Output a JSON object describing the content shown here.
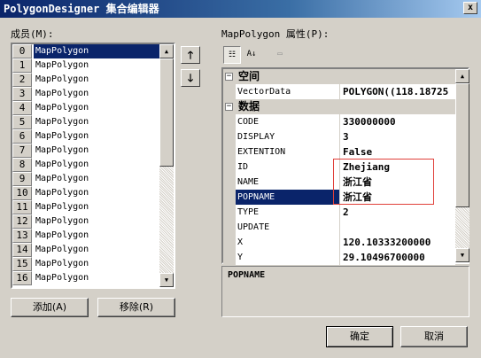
{
  "window": {
    "title": "PolygonDesigner 集合编辑器",
    "close_glyph": "x"
  },
  "members": {
    "label": "成员(M):",
    "items": [
      {
        "index": "0",
        "name": "MapPolygon",
        "selected": true
      },
      {
        "index": "1",
        "name": "MapPolygon"
      },
      {
        "index": "2",
        "name": "MapPolygon"
      },
      {
        "index": "3",
        "name": "MapPolygon"
      },
      {
        "index": "4",
        "name": "MapPolygon"
      },
      {
        "index": "5",
        "name": "MapPolygon"
      },
      {
        "index": "6",
        "name": "MapPolygon"
      },
      {
        "index": "7",
        "name": "MapPolygon"
      },
      {
        "index": "8",
        "name": "MapPolygon"
      },
      {
        "index": "9",
        "name": "MapPolygon"
      },
      {
        "index": "10",
        "name": "MapPolygon"
      },
      {
        "index": "11",
        "name": "MapPolygon"
      },
      {
        "index": "12",
        "name": "MapPolygon"
      },
      {
        "index": "13",
        "name": "MapPolygon"
      },
      {
        "index": "14",
        "name": "MapPolygon"
      },
      {
        "index": "15",
        "name": "MapPolygon"
      },
      {
        "index": "16",
        "name": "MapPolygon"
      }
    ],
    "add_label": "添加(A)",
    "remove_label": "移除(R)"
  },
  "properties": {
    "label": "MapPolygon 属性(P):",
    "categories": [
      {
        "name": "空间",
        "expander": "⊟",
        "rows": [
          {
            "key": "VectorData",
            "value": "POLYGON((118.18725"
          }
        ]
      },
      {
        "name": "数据",
        "expander": "⊟",
        "rows": [
          {
            "key": "CODE",
            "value": "330000000"
          },
          {
            "key": "DISPLAY",
            "value": "3"
          },
          {
            "key": "EXTENTION",
            "value": "False"
          },
          {
            "key": "ID",
            "value": "Zhejiang"
          },
          {
            "key": "NAME",
            "value": "浙江省"
          },
          {
            "key": "POPNAME",
            "value": "浙江省",
            "selected": true
          },
          {
            "key": "TYPE",
            "value": "2"
          },
          {
            "key": "UPDATE",
            "value": ""
          },
          {
            "key": "X",
            "value": "120.10333200000"
          },
          {
            "key": "Y",
            "value": "29.10496700000"
          }
        ]
      }
    ],
    "description": "POPNAME"
  },
  "buttons": {
    "ok": "确定",
    "cancel": "取消"
  },
  "icons": {
    "move_up": "arrow-up-icon",
    "move_down": "arrow-down-icon",
    "categorized": "categorized-icon",
    "alphabetical": "alphabetical-icon",
    "property_pages": "property-pages-icon"
  },
  "colors": {
    "selection": "#0a246a",
    "highlight_box": "#e0403a",
    "face": "#d4d0c8"
  }
}
